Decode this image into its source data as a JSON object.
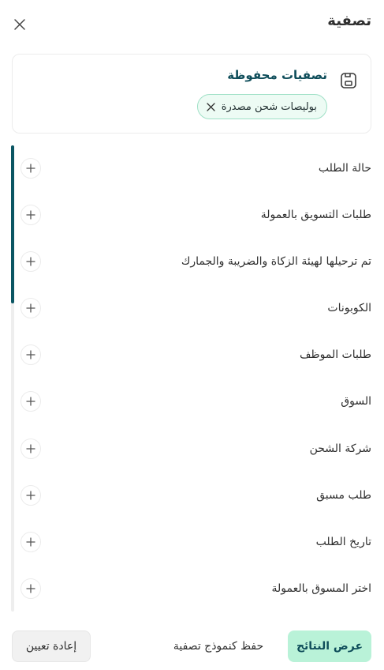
{
  "header": {
    "title": "تصفية"
  },
  "saved": {
    "title": "تصفيات محفوظة",
    "chip_label": "بوليصات شحن مصدرة"
  },
  "filters": [
    {
      "label": "حالة الطلب"
    },
    {
      "label": "طلبات التسويق بالعمولة"
    },
    {
      "label": "تم ترحيلها لهيئة الزكاة والضريبة والجمارك"
    },
    {
      "label": "الكوبونات"
    },
    {
      "label": "طلبات الموظف"
    },
    {
      "label": "السوق"
    },
    {
      "label": "شركة الشحن"
    },
    {
      "label": "طلب مسبق"
    },
    {
      "label": "تاريخ الطلب"
    },
    {
      "label": "اختر المسوق بالعمولة"
    }
  ],
  "footer": {
    "apply_label": "عرض النتائج",
    "save_label": "حفظ كنموذج تصفية",
    "reset_label": "إعادة تعيين"
  },
  "icons": {
    "close": "close-icon",
    "save": "floppy-disk-icon",
    "chip_remove": "close-icon",
    "expand": "plus-icon"
  },
  "colors": {
    "accent": "#0e4d5a",
    "scrollbar_thumb": "#0b5663",
    "chip_bg": "#edfbf4",
    "chip_border": "#9fe0c6",
    "apply_bg": "#b9f2d8"
  }
}
